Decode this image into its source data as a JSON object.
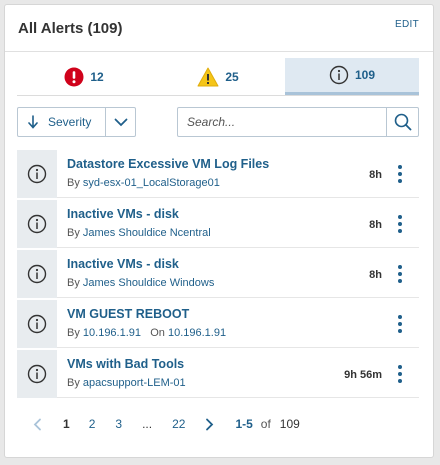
{
  "widget": {
    "title": "All Alerts (109)",
    "edit_label": "EDIT"
  },
  "tabs": [
    {
      "icon": "critical-alert-icon",
      "count": "12",
      "color": "#d0021b"
    },
    {
      "icon": "warning-alert-icon",
      "count": "25",
      "color": "#f5c518"
    },
    {
      "icon": "info-alert-icon",
      "count": "109",
      "color": "#333333",
      "active": true
    }
  ],
  "controls": {
    "sort_label": "Severity",
    "sort_icon": "arrow-down-icon",
    "dropdown_icon": "chevron-down-icon",
    "search_placeholder": "Search...",
    "search_icon": "search-icon"
  },
  "alerts": [
    {
      "name": "Datastore Excessive VM Log Files",
      "by_label": "By",
      "by": "syd-esx-01_LocalStorage01",
      "on_label": "",
      "on": "",
      "time": "8h"
    },
    {
      "name": "Inactive VMs - disk",
      "by_label": "By",
      "by": "James Shouldice Ncentral",
      "on_label": "",
      "on": "",
      "time": "8h"
    },
    {
      "name": "Inactive VMs - disk",
      "by_label": "By",
      "by": "James Shouldice Windows",
      "on_label": "",
      "on": "",
      "time": "8h"
    },
    {
      "name": "VM GUEST REBOOT",
      "by_label": "By",
      "by": "10.196.1.91",
      "on_label": "On",
      "on": "10.196.1.91",
      "time": ""
    },
    {
      "name": "VMs with Bad Tools",
      "by_label": "By",
      "by": "apacsupport-LEM-01",
      "on_label": "",
      "on": "",
      "time": "9h 56m"
    }
  ],
  "pagination": {
    "pages": [
      "1",
      "2",
      "3",
      "...",
      "22"
    ],
    "current": "1",
    "range": "1-5",
    "of_label": "of",
    "total": "109"
  },
  "colors": {
    "accent": "#1f5f8a",
    "critical": "#d0021b",
    "warning": "#f5c518",
    "active_tab": "#dfe9f2"
  }
}
